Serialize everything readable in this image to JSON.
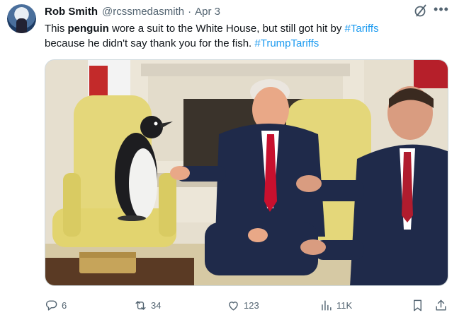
{
  "post": {
    "author_name": "Rob Smith",
    "author_handle": "@rcssmedasmith",
    "separator": "·",
    "date": "Apr 3",
    "text": {
      "part1": "This ",
      "bold": "penguin",
      "part2": " wore a suit to the White House, but still got hit by ",
      "hashtag1": "#Tariffs",
      "part3": " because he didn't say thank you for the fish. ",
      "hashtag2": "#TrumpTariffs"
    }
  },
  "actions": {
    "replies": "6",
    "reposts": "34",
    "likes": "123",
    "views": "11K"
  },
  "icons": {
    "grok": "grok-slash-icon",
    "more": "more-dots-icon",
    "reply": "reply-bubble-icon",
    "repost": "repost-arrows-icon",
    "like": "heart-icon",
    "views": "bar-chart-icon",
    "bookmark": "bookmark-icon",
    "share": "share-upload-icon"
  },
  "colors": {
    "text": "#0f1419",
    "secondary": "#536471",
    "link": "#1d9bf0",
    "border": "#cfd9de"
  }
}
